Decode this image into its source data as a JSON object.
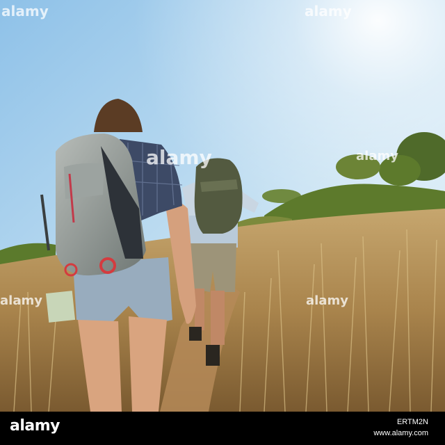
{
  "watermark": {
    "brand": "alamy",
    "image_id": "ERTM2N",
    "site": "www.alamy.com"
  },
  "colors": {
    "sky_top": "#8ec1e8",
    "sky_bottom": "#d9ecf6",
    "grass": "#b9915a",
    "shrub": "#5d7a2c",
    "backpack_grey": "#8e9693",
    "backpack_dark": "#535a40",
    "shirt_plaid": "#3d4a66",
    "shorts_denim": "#98acbe",
    "footer_bg": "#000000"
  },
  "scene": {
    "subjects": [
      "hiker-woman",
      "hiker-man"
    ]
  }
}
